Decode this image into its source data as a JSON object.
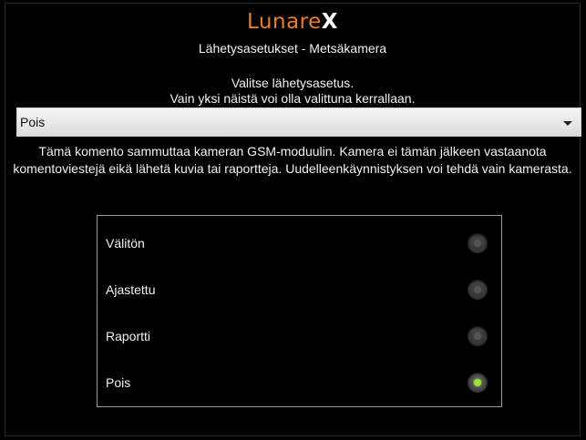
{
  "logo": {
    "part1": "Lunare",
    "part2": "X"
  },
  "header": {
    "subtitle": "Lähetysasetukset - Metsäkamera"
  },
  "instructions": {
    "line1": "Valitse lähetysasetus.",
    "line2": "Vain yksi näistä voi olla valittuna kerrallaan."
  },
  "dropdown": {
    "selected": "Pois"
  },
  "description": "Tämä komento sammuttaa kameran GSM-moduulin. Kamera ei tämän jälkeen vastaanota komentoviestejä eikä lähetä kuvia tai raportteja. Uudelleenkäynnistyksen voi tehdä vain kamerasta.",
  "options": [
    {
      "label": "Välitön",
      "checked": false
    },
    {
      "label": "Ajastettu",
      "checked": false
    },
    {
      "label": "Raportti",
      "checked": false
    },
    {
      "label": "Pois",
      "checked": true
    }
  ],
  "colors": {
    "accent": "#f07d1a",
    "radio_on": "#9be33a",
    "background": "#000000"
  }
}
